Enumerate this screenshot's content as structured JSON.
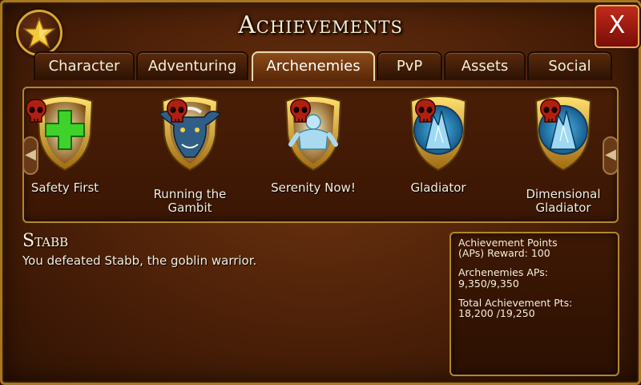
{
  "window": {
    "title": "Achievements",
    "close_label": "X",
    "badge_icon": "star-icon"
  },
  "tabs": [
    {
      "label": "Character"
    },
    {
      "label": "Adventuring"
    },
    {
      "label": "Archenemies",
      "active": true
    },
    {
      "label": "PvP"
    },
    {
      "label": "Assets"
    },
    {
      "label": "Social"
    }
  ],
  "achievements": [
    {
      "label": "Safety First",
      "icon": "green-cross-icon"
    },
    {
      "label": "Running the Gambit",
      "line1": "Running the",
      "line2": "Gambit",
      "icon": "minotaur-icon"
    },
    {
      "label": "Serenity Now!",
      "icon": "ice-golem-icon"
    },
    {
      "label": "Gladiator",
      "icon": "ice-crystal-icon"
    },
    {
      "label": "Dimensional Gladiator",
      "line1": "Dimensional",
      "line2": "Gladiator",
      "icon": "ice-crystal-icon"
    }
  ],
  "detail": {
    "name": "Stabb",
    "description": "You defeated Stabb, the goblin warrior."
  },
  "points": {
    "reward_label_1": "Achievement Points",
    "reward_label_2": "(APs) Reward: 100",
    "category_label": "Archenemies APs:",
    "category_value": "9,350/9,350",
    "total_label": "Total Achievement Pts:",
    "total_value": "18,200 /19,250"
  },
  "colors": {
    "background": "#4c2008",
    "gold_border": "#b08828",
    "close_red": "#c02a1c",
    "text": "#f4eedc"
  }
}
